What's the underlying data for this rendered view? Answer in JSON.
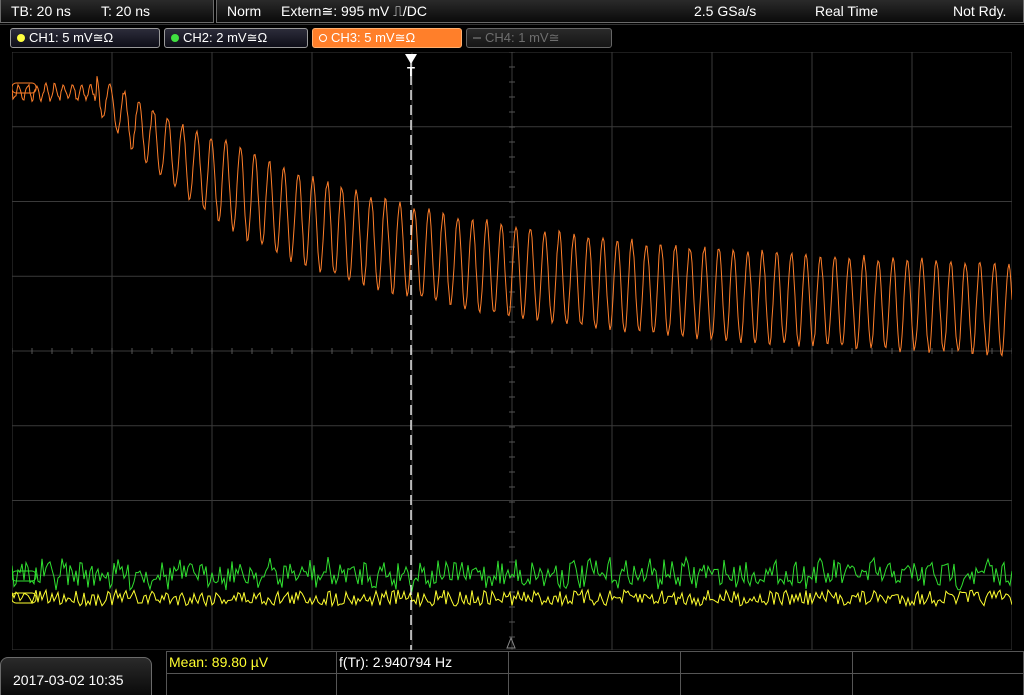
{
  "top_bar": {
    "timebase": "TB: 20 ns",
    "trigger_time": "T: 20 ns",
    "trigger_mode": "Norm",
    "trigger_source": "Extern≅: 995 mV ⎍/DC",
    "sample_rate": "2.5 GSa/s",
    "acquisition_mode": "Real Time",
    "status": "Not Rdy."
  },
  "channels": [
    {
      "label": "CH1: 5 mV≅Ω",
      "color": "#ffff40",
      "active": true
    },
    {
      "label": "CH2: 2 mV≅Ω",
      "color": "#40e040",
      "active": true
    },
    {
      "label": "CH3: 5 mV≅Ω",
      "color": "#ff7f2a",
      "active": true
    },
    {
      "label": "CH4: 1 mV≅",
      "color": "#6e6e6e",
      "active": false
    }
  ],
  "markers": {
    "trigger_marker": "T"
  },
  "bottom_bar": {
    "datetime": "2017-03-02 10:35",
    "mean": "Mean: 89.80 µV",
    "frequency": "f(Tr): 2.940794 Hz"
  },
  "colors": {
    "grid": "#3a3a3a",
    "ch1_trace": "#ffff30",
    "ch2_trace": "#30e030",
    "ch3_trace": "#ff7f2a"
  }
}
